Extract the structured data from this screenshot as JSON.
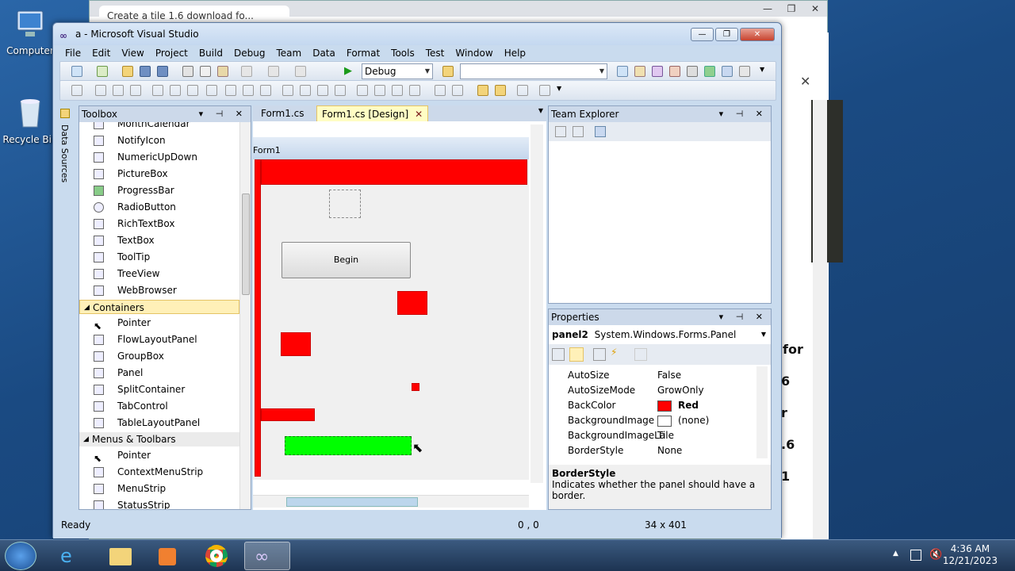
{
  "desktop": {
    "icons": [
      {
        "label": "Computer"
      },
      {
        "label": "Recycle Bin"
      }
    ]
  },
  "browser": {
    "tab_title": "Create a tile 1.6 download fo...",
    "page_fragments": [
      "for",
      "6",
      "r",
      ".6",
      "1"
    ],
    "close_x": "✕"
  },
  "vs": {
    "title": "a - Microsoft Visual Studio",
    "logo_glyph": "∞",
    "window_buttons": {
      "minimize": "—",
      "restore": "❐",
      "close": "✕"
    },
    "menu": [
      "File",
      "Edit",
      "View",
      "Project",
      "Build",
      "Debug",
      "Team",
      "Data",
      "Format",
      "Tools",
      "Test",
      "Window",
      "Help"
    ],
    "toolbar": {
      "config": "Debug",
      "platform": "",
      "start_glyph": "▶"
    },
    "side_strip": {
      "label": "Data Sources"
    },
    "toolbox": {
      "title": "Toolbox",
      "items_top": [
        "MonthCalendar",
        "NotifyIcon",
        "NumericUpDown",
        "PictureBox",
        "ProgressBar",
        "RadioButton",
        "RichTextBox",
        "TextBox",
        "ToolTip",
        "TreeView",
        "WebBrowser"
      ],
      "containers": {
        "label": "Containers",
        "items": [
          "Pointer",
          "FlowLayoutPanel",
          "GroupBox",
          "Panel",
          "SplitContainer",
          "TabControl",
          "TableLayoutPanel"
        ]
      },
      "menus": {
        "label": "Menus & Toolbars",
        "items": [
          "Pointer",
          "ContextMenuStrip",
          "MenuStrip",
          "StatusStrip"
        ]
      }
    },
    "designer": {
      "tabs": [
        {
          "label": "Form1.cs"
        },
        {
          "label": "Form1.cs [Design]"
        }
      ],
      "form_title": "Form1",
      "button_label": "Begin"
    },
    "team_explorer": {
      "title": "Team Explorer"
    },
    "properties": {
      "title": "Properties",
      "object": "panel2",
      "object_type": "System.Windows.Forms.Panel",
      "rows": [
        {
          "name": "AutoSize",
          "value": "False"
        },
        {
          "name": "AutoSizeMode",
          "value": "GrowOnly"
        },
        {
          "name": "BackColor",
          "value": "Red",
          "swatch": "#ff0000"
        },
        {
          "name": "BackgroundImage",
          "value": "(none)",
          "swatch": "#ffffff"
        },
        {
          "name": "BackgroundImageLa",
          "value": "Tile"
        },
        {
          "name": "BorderStyle",
          "value": "None"
        }
      ],
      "desc_title": "BorderStyle",
      "desc_text": "Indicates whether the panel should have a border."
    },
    "status": {
      "left": "Ready",
      "position": "0 , 0",
      "size": "34 x 401"
    }
  },
  "taskbar": {
    "time": "4:36 AM",
    "date": "12/21/2023"
  },
  "colors": {
    "red": "#ff0000",
    "green": "#00ff00",
    "accent": "#ccd9ea"
  }
}
